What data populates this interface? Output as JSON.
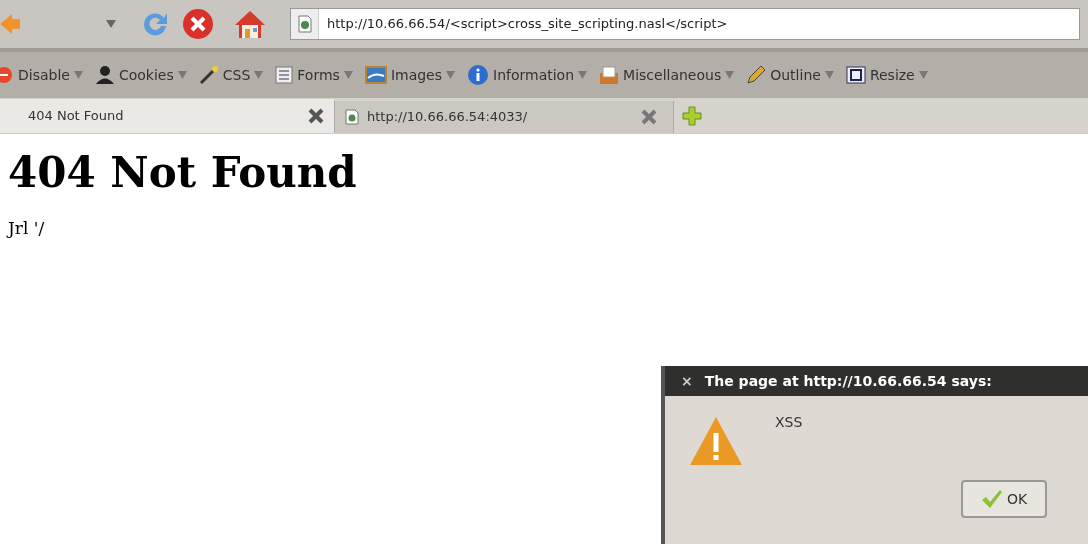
{
  "address_bar": {
    "url": "http://10.66.66.54/<script>cross_site_scripting.nasl</script>"
  },
  "toolbar": [
    {
      "label": "Disable"
    },
    {
      "label": "Cookies"
    },
    {
      "label": "CSS"
    },
    {
      "label": "Forms"
    },
    {
      "label": "Images"
    },
    {
      "label": "Information"
    },
    {
      "label": "Miscellaneous"
    },
    {
      "label": "Outline"
    },
    {
      "label": "Resize"
    }
  ],
  "tabs": [
    {
      "label": "404 Not Found",
      "selected": true
    },
    {
      "label": "http://10.66.66.54:4033/",
      "selected": false
    }
  ],
  "page": {
    "heading": "404 Not Found",
    "text": "Jrl '/"
  },
  "dialog": {
    "close": "×",
    "title": "The page at http://10.66.66.54 says:",
    "message": "XSS",
    "button": "OK"
  }
}
